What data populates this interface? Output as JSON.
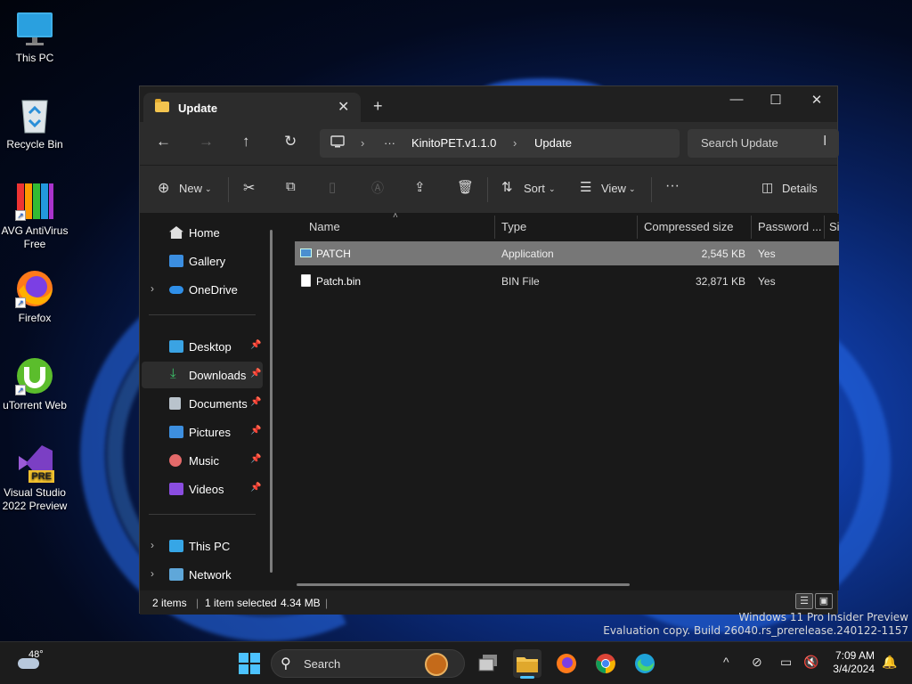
{
  "desktop": {
    "icons": [
      {
        "label": "This PC"
      },
      {
        "label": "Recycle Bin"
      },
      {
        "label": "AVG AntiVirus Free"
      },
      {
        "label": "Firefox"
      },
      {
        "label": "uTorrent Web"
      },
      {
        "label": "Visual Studio 2022 Preview"
      }
    ],
    "vs_badge": "PRE"
  },
  "window": {
    "tab_title": "Update",
    "tab_close": "✕",
    "new_tab": "+",
    "controls": {
      "minimize": "—",
      "maximize": "☐",
      "close": "✕"
    },
    "nav": {
      "back": "←",
      "forward": "→",
      "up": "↑",
      "refresh": "↻"
    },
    "address": {
      "more": "···",
      "crumbs": [
        "KinitoPET.v1.1.0",
        "Update"
      ],
      "separator": "›"
    },
    "search_placeholder": "Search Update",
    "toolbar": {
      "new_label": "New",
      "sort_label": "Sort",
      "view_label": "View",
      "more": "···",
      "details_label": "Details"
    },
    "sidebar": {
      "items": [
        {
          "label": "Home"
        },
        {
          "label": "Gallery"
        },
        {
          "label": "OneDrive"
        },
        {
          "label": "Desktop"
        },
        {
          "label": "Downloads"
        },
        {
          "label": "Documents"
        },
        {
          "label": "Pictures"
        },
        {
          "label": "Music"
        },
        {
          "label": "Videos"
        },
        {
          "label": "This PC"
        },
        {
          "label": "Network"
        }
      ]
    },
    "columns": [
      "Name",
      "Type",
      "Compressed size",
      "Password ...",
      "Si"
    ],
    "files": [
      {
        "name": "PATCH",
        "type": "Application",
        "size": "2,545 KB",
        "password": "Yes",
        "selected": true
      },
      {
        "name": "Patch.bin",
        "type": "BIN File",
        "size": "32,871 KB",
        "password": "Yes",
        "selected": false
      }
    ],
    "status": {
      "items": "2 items",
      "selection": "1 item selected",
      "size": "4.34 MB"
    }
  },
  "watermark": {
    "line1": "Windows 11 Pro Insider Preview",
    "line2": "Evaluation copy. Build 26040.rs_prerelease.240122-1157"
  },
  "taskbar": {
    "weather_temp": "48°",
    "search_label": "Search",
    "time": "7:09 AM",
    "date": "3/4/2024"
  },
  "colors": {
    "selected_row": "#777777",
    "window_bg": "#191919",
    "toolbar_bg": "#2c2c2c",
    "accent_blue": "#0078d4"
  }
}
